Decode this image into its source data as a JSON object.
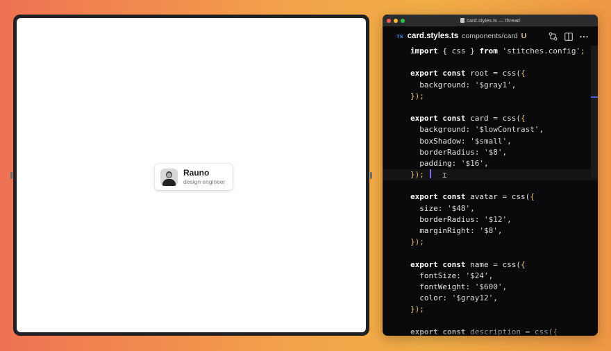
{
  "preview": {
    "card": {
      "name": "Rauno",
      "description": "design engineer"
    }
  },
  "editor": {
    "window_title": "card.styles.ts — thread",
    "tab": {
      "badge": "TS",
      "file": "card.styles.ts",
      "path": "components/card",
      "status": "U"
    },
    "actions": [
      "source-control-icon",
      "split-editor-icon",
      "more-icon"
    ],
    "code_lines": [
      [
        [
          "kw",
          "import"
        ],
        [
          "txt",
          " { css } "
        ],
        [
          "kw",
          "from"
        ],
        [
          "str",
          " 'stitches.config'"
        ],
        [
          "pun",
          ";"
        ]
      ],
      [],
      [
        [
          "kw",
          "export const"
        ],
        [
          "txt",
          " root = css("
        ],
        [
          "pun",
          "{"
        ]
      ],
      [
        [
          "txt",
          "  background: "
        ],
        [
          "str",
          "'$gray1'"
        ],
        [
          "txt",
          ","
        ]
      ],
      [
        [
          "pun",
          "});"
        ]
      ],
      [],
      [
        [
          "kw",
          "export const"
        ],
        [
          "txt",
          " card = css("
        ],
        [
          "pun",
          "{"
        ]
      ],
      [
        [
          "txt",
          "  background: "
        ],
        [
          "str",
          "'$lowContrast'"
        ],
        [
          "txt",
          ","
        ]
      ],
      [
        [
          "txt",
          "  boxShadow: "
        ],
        [
          "str",
          "'$small'"
        ],
        [
          "txt",
          ","
        ]
      ],
      [
        [
          "txt",
          "  borderRadius: "
        ],
        [
          "str",
          "'$8'"
        ],
        [
          "txt",
          ","
        ]
      ],
      [
        [
          "txt",
          "  padding: "
        ],
        [
          "str",
          "'$16'"
        ],
        [
          "txt",
          ","
        ]
      ],
      [
        [
          "pun",
          "});"
        ]
      ],
      [],
      [
        [
          "kw",
          "export const"
        ],
        [
          "txt",
          " avatar = css("
        ],
        [
          "pun",
          "{"
        ]
      ],
      [
        [
          "txt",
          "  size: "
        ],
        [
          "str",
          "'$48'"
        ],
        [
          "txt",
          ","
        ]
      ],
      [
        [
          "txt",
          "  borderRadius: "
        ],
        [
          "str",
          "'$12'"
        ],
        [
          "txt",
          ","
        ]
      ],
      [
        [
          "txt",
          "  marginRight: "
        ],
        [
          "str",
          "'$8'"
        ],
        [
          "txt",
          ","
        ]
      ],
      [
        [
          "pun",
          "});"
        ]
      ],
      [],
      [
        [
          "kw",
          "export const"
        ],
        [
          "txt",
          " name = css("
        ],
        [
          "pun",
          "{"
        ]
      ],
      [
        [
          "txt",
          "  fontSize: "
        ],
        [
          "str",
          "'$24'"
        ],
        [
          "txt",
          ","
        ]
      ],
      [
        [
          "txt",
          "  fontWeight: "
        ],
        [
          "str",
          "'$600'"
        ],
        [
          "txt",
          ","
        ]
      ],
      [
        [
          "txt",
          "  color: "
        ],
        [
          "str",
          "'$gray12'"
        ],
        [
          "txt",
          ","
        ]
      ],
      [
        [
          "pun",
          "});"
        ]
      ],
      [],
      [
        [
          "kw",
          "export const"
        ],
        [
          "txt",
          " description = css("
        ],
        [
          "pun",
          "{"
        ]
      ]
    ],
    "active_line": 11,
    "colors": {
      "keyword": "#ffffff",
      "string": "#d9d9d9",
      "punctuation": "#e8c07a",
      "ts_badge": "#3b8eea",
      "untracked": "#e2c08d",
      "cursor": "#7c6cf6"
    }
  }
}
